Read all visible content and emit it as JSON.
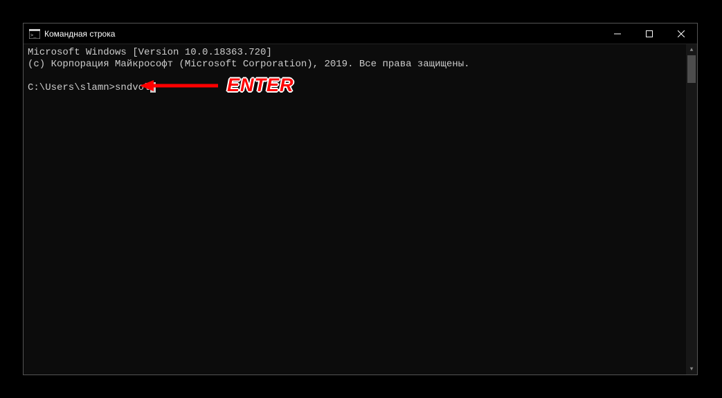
{
  "window": {
    "title": "Командная строка"
  },
  "terminal": {
    "line1": "Microsoft Windows [Version 10.0.18363.720]",
    "line2": "(c) Корпорация Майкрософт (Microsoft Corporation), 2019. Все права защищены.",
    "prompt": "C:\\Users\\slamn>",
    "command": "sndvol"
  },
  "annotation": {
    "text": "ENTER"
  }
}
